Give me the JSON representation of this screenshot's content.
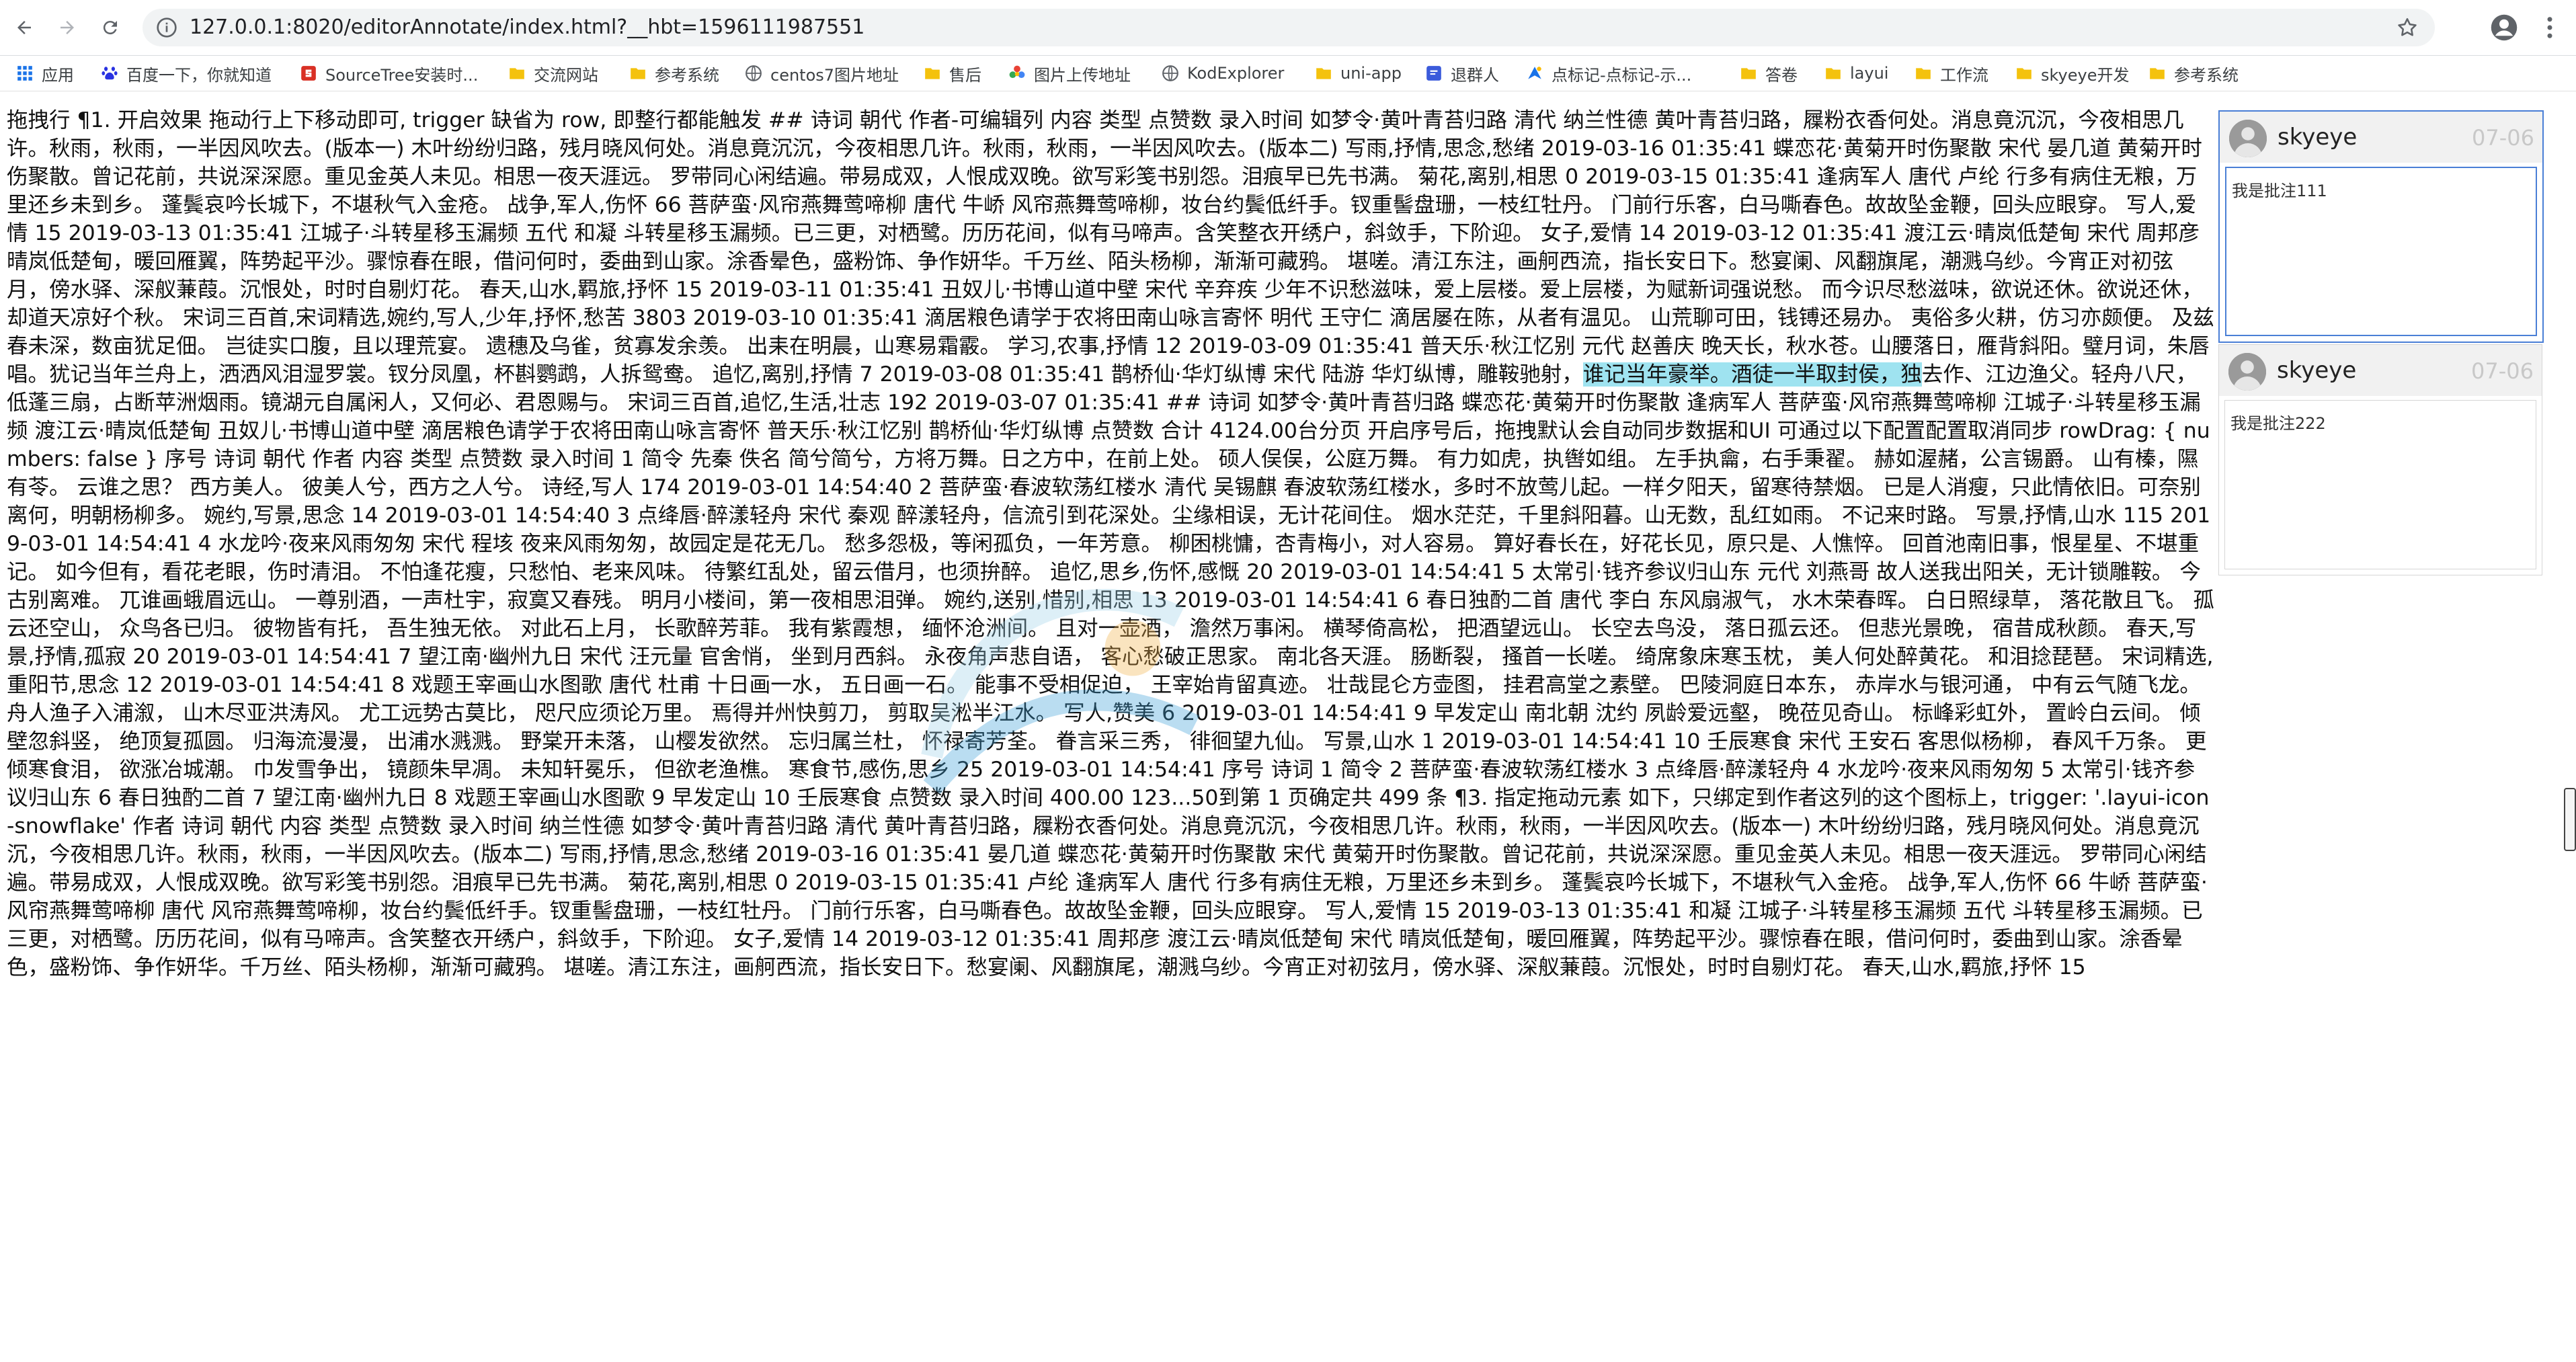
{
  "browser": {
    "url": "127.0.0.1:8020/editorAnnotate/index.html?__hbt=1596111987551",
    "bookmarks": [
      {
        "label": "应用",
        "icon": "apps-grid-icon",
        "color": "#1a73e8"
      },
      {
        "label": "百度一下，你就知道",
        "icon": "baidu-paw-icon",
        "color": "#2932e1"
      },
      {
        "label": "SourceTree安装时...",
        "icon": "sourcetree-icon",
        "color": "#d93025"
      },
      {
        "label": "交流网站",
        "icon": "folder-icon",
        "color": "#f4c20d"
      },
      {
        "label": "参考系统",
        "icon": "folder-icon",
        "color": "#f4c20d"
      },
      {
        "label": "centos7图片地址",
        "icon": "globe-icon",
        "color": "#5f6368"
      },
      {
        "label": "售后",
        "icon": "folder-icon",
        "color": "#f4c20d"
      },
      {
        "label": "图片上传地址",
        "icon": "flower-icon",
        "color": "#e94235"
      },
      {
        "label": "KodExplorer",
        "icon": "globe-icon",
        "color": "#5f6368"
      },
      {
        "label": "uni-app",
        "icon": "folder-icon",
        "color": "#f4c20d"
      },
      {
        "label": "退群人",
        "icon": "blue-square-icon",
        "color": "#3b5bdb"
      },
      {
        "label": "点标记-点标记-示...",
        "icon": "amap-icon",
        "color": "#1a73e8"
      },
      {
        "label": "答卷",
        "icon": "folder-icon",
        "color": "#f4c20d"
      },
      {
        "label": "layui",
        "icon": "folder-icon",
        "color": "#f4c20d"
      },
      {
        "label": "工作流",
        "icon": "folder-icon",
        "color": "#f4c20d"
      },
      {
        "label": "skyeye开发",
        "icon": "folder-icon",
        "color": "#f4c20d"
      },
      {
        "label": "参考系统",
        "icon": "folder-icon",
        "color": "#f4c20d"
      }
    ]
  },
  "editor": {
    "text_before": "拖拽行 ¶1. 开启效果 拖动行上下移动即可, trigger 缺省为 row, 即整行都能触发 ## 诗词 朝代 作者-可编辑列 内容 类型 点赞数 录入时间 如梦令·黄叶青苔归路 清代 纳兰性德 黄叶青苔归路，屧粉衣香何处。消息竟沉沉，今夜相思几许。秋雨，秋雨，一半因风吹去。(版本一) 木叶纷纷归路，残月晓风何处。消息竟沉沉，今夜相思几许。秋雨，秋雨，一半因风吹去。(版本二) 写雨,抒情,思念,愁绪 2019-03-16 01:35:41 蝶恋花·黄菊开时伤聚散 宋代 晏几道 黄菊开时伤聚散。曾记花前，共说深深愿。重见金英人未见。相思一夜天涯远。 罗带同心闲结遍。带易成双，人恨成双晚。欲写彩笺书别怨。泪痕早已先书满。 菊花,离别,相思 0 2019-03-15 01:35:41 逢病军人 唐代 卢纶 行多有病住无粮，万里还乡未到乡。 蓬鬓哀吟长城下，不堪秋气入金疮。 战争,军人,伤怀 66 菩萨蛮·风帘燕舞莺啼柳 唐代 牛峤 风帘燕舞莺啼柳，妆台约鬓低纤手。钗重髻盘珊，一枝红牡丹。 门前行乐客，白马嘶春色。故故坠金鞭，回头应眼穿。 写人,爱情 15 2019-03-13 01:35:41 江城子·斗转星移玉漏频 五代 和凝 斗转星移玉漏频。已三更，对栖鹭。历历花间，似有马啼声。含笑整衣开绣户，斜敛手，下阶迎。 女子,爱情 14 2019-03-12 01:35:41 渡江云·晴岚低楚甸 宋代 周邦彦 晴岚低楚甸，暖回雁翼，阵势起平沙。骤惊春在眼，借问何时，委曲到山家。涂香晕色，盛粉饰、争作妍华。千万丝、陌头杨柳，渐渐可藏鸦。 堪嗟。清江东注，画舸西流，指长安日下。愁宴阑、风翻旗尾，潮溅乌纱。今宵正对初弦月，傍水驿、深舣蒹葭。沉恨处，时时自剔灯花。 春天,山水,羁旅,抒怀 15 2019-03-11 01:35:41 丑奴儿·书博山道中壁 宋代 辛弃疾 少年不识愁滋味，爱上层楼。爱上层楼，为赋新词强说愁。 而今识尽愁滋味，欲说还休。欲说还休，却道天凉好个秋。 宋词三百首,宋词精选,婉约,写人,少年,抒怀,愁苦 3803 2019-03-10 01:35:41 滴居粮色请学于农将田南山咏言寄怀 明代 王守仁 滴居屡在陈，从者有温见。 山荒聊可田，钱镈还易办。 夷俗多火耕，仿习亦颇便。 及兹春未深，数亩犹足佃。 岂徒实口腹，且以理荒宴。 遗穗及乌雀，贫寡发余羡。 出耒在明晨，山寒易霜霰。 学习,农事,抒情 12 2019-03-09 01:35:41 普天乐·秋江忆别 元代 赵善庆 晚天长，秋水苍。山腰落日，雁背斜阳。璧月词，朱唇唱。犹记当年兰舟上，洒洒风泪湿罗裳。钗分凤凰，杯斟鹦鹉，人拆鸳鸯。 追忆,离别,抒情 7 2019-03-08 01:35:41 鹊桥仙·华灯纵博 宋代 陆游 华灯纵博，雕鞍驰射，",
    "highlight": "谁记当年豪举。酒徒一半取封侯，独",
    "text_after": "去作、江边渔父。轻舟八尺，低蓬三扇，占断苹洲烟雨。镜湖元自属闲人，又何必、君恩赐与。 宋词三百首,追忆,生活,壮志 192 2019-03-07 01:35:41 ## 诗词 如梦令·黄叶青苔归路 蝶恋花·黄菊开时伤聚散 逢病军人 菩萨蛮·风帘燕舞莺啼柳 江城子·斗转星移玉漏频 渡江云·晴岚低楚甸 丑奴儿·书博山道中壁 滴居粮色请学于农将田南山咏言寄怀 普天乐·秋江忆别 鹊桥仙·华灯纵博 点赞数 合计 4124.00台分页 开启序号后，拖拽默认会自动同步数据和UI 可通过以下配置配置取消同步 rowDrag: { numbers: false } 序号 诗词 朝代 作者 内容 类型 点赞数 录入时间 1 简令 先秦 佚名 简兮简兮，方将万舞。日之方中，在前上处。 硕人俣俣，公庭万舞。 有力如虎，执辔如组。 左手执龠，右手秉翟。 赫如渥赭，公言锡爵。 山有榛，隰有苓。 云谁之思？ 西方美人。 彼美人兮，西方之人兮。 诗经,写人 174 2019-03-01 14:54:40 2 菩萨蛮·春波软荡红楼水 清代 吴锡麒 春波软荡红楼水，多时不放莺儿起。一样夕阳天，留寒待禁烟。 已是人消瘦，只此情依旧。可奈别离何，明朝杨柳多。 婉约,写景,思念 14 2019-03-01 14:54:40 3 点绛唇·醉漾轻舟 宋代 秦观 醉漾轻舟，信流引到花深处。尘缘相误，无计花间住。 烟水茫茫，千里斜阳暮。山无数，乱红如雨。 不记来时路。 写景,抒情,山水 115 2019-03-01 14:54:41 4 水龙吟·夜来风雨匆匆 宋代 程垓 夜来风雨匆匆，故园定是花无几。 愁多怨极，等闲孤负，一年芳意。 柳困桃慵，杏青梅小，对人容易。 算好春长在，好花长见，原只是、人憔悴。 回首池南旧事，恨星星、不堪重记。 如今但有，看花老眼，伤时清泪。 不怕逢花瘦，只愁怕、老来风味。 待繁红乱处，留云借月，也须拚醉。 追忆,思乡,伤怀,感慨 20 2019-03-01 14:54:41 5 太常引·钱齐参议归山东 元代 刘燕哥 故人送我出阳关，无计锁雕鞍。 今古别离难。 兀谁画蛾眉远山。 一尊别酒，一声杜宇，寂寞又春残。 明月小楼间，第一夜相思泪弹。 婉约,送别,惜别,相思 13 2019-03-01 14:54:41 6 春日独酌二首 唐代 李白 东风扇淑气， 水木荣春晖。 白日照绿草， 落花散且飞。 孤云还空山， 众鸟各已归。 彼物皆有托， 吾生独无依。 对此石上月， 长歌醉芳菲。 我有紫霞想， 缅怀沧洲间。 且对一壶酒， 澹然万事闲。 横琴倚高松， 把酒望远山。 长空去鸟没， 落日孤云还。 但悲光景晚， 宿昔成秋颜。 春天,写景,抒情,孤寂 20 2019-03-01 14:54:41 7 望江南·幽州九日 宋代 汪元量 官舍悄， 坐到月西斜。 永夜角声悲自语， 客心愁破正思家。 南北各天涯。 肠断裂， 搔首一长嗟。 绮席象床寒玉枕， 美人何处醉黄花。 和泪捻琵琶。 宋词精选,重阳节,思念 12 2019-03-01 14:54:41 8 戏题王宰画山水图歌 唐代 杜甫 十日画一水， 五日画一石。 能事不受相促迫， 王宰始肯留真迹。 壮哉昆仑方壶图， 挂君高堂之素壁。 巴陵洞庭日本东， 赤岸水与银河通， 中有云气随飞龙。 舟人渔子入浦溆， 山木尽亚洪涛风。 尤工远势古莫比， 咫尺应须论万里。 焉得并州快剪刀， 剪取吴淞半江水。 写人,赞美 6 2019-03-01 14:54:41 9 早发定山 南北朝 沈约 夙龄爱远壑， 晚莅见奇山。 标峰彩虹外， 置岭白云间。 倾壁忽斜竖， 绝顶复孤圆。 归海流漫漫， 出浦水溅溅。 野棠开未落， 山樱发欲然。 忘归属兰杜， 怀禄寄芳荃。 眷言采三秀， 徘徊望九仙。 写景,山水 1 2019-03-01 14:54:41 10 壬辰寒食 宋代 王安石 客思似杨柳， 春风千万条。 更倾寒食泪， 欲涨冶城潮。 巾发雪争出， 镜颜朱早凋。 未知轩冕乐， 但欲老渔樵。 寒食节,感伤,思乡 25 2019-03-01 14:54:41 序号 诗词 1 简令 2 菩萨蛮·春波软荡红楼水 3 点绛唇·醉漾轻舟 4 水龙吟·夜来风雨匆匆 5 太常引·钱齐参议归山东 6 春日独酌二首 7 望江南·幽州九日 8 戏题王宰画山水图歌 9 早发定山 10 壬辰寒食 点赞数 录入时间 400.00 123...50到第 1 页确定共 499 条 ¶3. 指定拖动元素 如下，只绑定到作者这列的这个图标上，trigger: '.layui-icon-snowflake' 作者 诗词 朝代 内容 类型 点赞数 录入时间 纳兰性德 如梦令·黄叶青苔归路 清代 黄叶青苔归路，屧粉衣香何处。消息竟沉沉，今夜相思几许。秋雨，秋雨，一半因风吹去。(版本一) 木叶纷纷归路，残月晓风何处。消息竟沉沉，今夜相思几许。秋雨，秋雨，一半因风吹去。(版本二) 写雨,抒情,思念,愁绪 2019-03-16 01:35:41 晏几道 蝶恋花·黄菊开时伤聚散 宋代 黄菊开时伤聚散。曾记花前，共说深深愿。重见金英人未见。相思一夜天涯远。 罗带同心闲结遍。带易成双，人恨成双晚。欲写彩笺书别怨。泪痕早已先书满。 菊花,离别,相思 0 2019-03-15 01:35:41 卢纶 逢病军人 唐代 行多有病住无粮，万里还乡未到乡。 蓬鬓哀吟长城下，不堪秋气入金疮。 战争,军人,伤怀 66 牛峤 菩萨蛮·风帘燕舞莺啼柳 唐代 风帘燕舞莺啼柳，妆台约鬓低纤手。钗重髻盘珊，一枝红牡丹。 门前行乐客，白马嘶春色。故故坠金鞭，回头应眼穿。 写人,爱情 15 2019-03-13 01:35:41 和凝 江城子·斗转星移玉漏频 五代 斗转星移玉漏频。已三更，对栖鹭。历历花间，似有马啼声。含笑整衣开绣户，斜敛手，下阶迎。 女子,爱情 14 2019-03-12 01:35:41 周邦彦 渡江云·晴岚低楚甸 宋代 晴岚低楚甸，暖回雁翼，阵势起平沙。骤惊春在眼，借问何时，委曲到山家。涂香晕色，盛粉饰、争作妍华。千万丝、陌头杨柳，渐渐可藏鸦。 堪嗟。清江东注，画舸西流，指长安日下。愁宴阑、风翻旗尾，潮溅乌纱。今宵正对初弦月，傍水驿、深舣蒹葭。沉恨处，时时自剔灯花。 春天,山水,羁旅,抒怀 15"
  },
  "annotations": [
    {
      "user": "skyeye",
      "date": "07-06",
      "text": "我是批注111",
      "active": true
    },
    {
      "user": "skyeye",
      "date": "07-06",
      "text": "我是批注222",
      "active": false
    }
  ],
  "colors": {
    "highlight": "#9fe3f0",
    "active_border": "#4a7fd6"
  }
}
